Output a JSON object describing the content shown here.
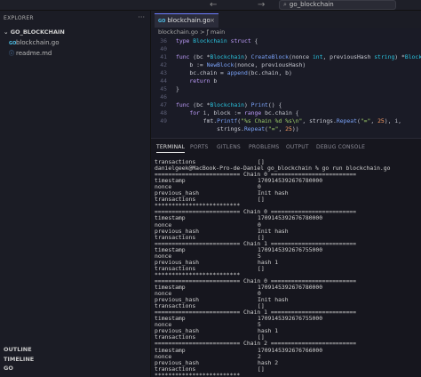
{
  "titlebar": {
    "back_icon": "arrow-left-icon",
    "forward_icon": "arrow-right-icon",
    "search_text": "go_blockchain"
  },
  "sidebar": {
    "header": "EXPLORER",
    "more": "···",
    "folder": "GO_BLOCKCHAIN",
    "files": [
      {
        "name": "blockchain.go",
        "icon": "go-file-icon"
      },
      {
        "name": "readme.md",
        "icon": "markdown-file-icon"
      }
    ],
    "bottom": [
      "OUTLINE",
      "TIMELINE",
      "GO"
    ]
  },
  "editor": {
    "tab": "blockchain.go",
    "breadcrumb": "blockchain.go > ƒ main",
    "lines": [
      {
        "n": "36",
        "t": "type Blockchain struct {"
      },
      {
        "n": "40",
        "t": ""
      },
      {
        "n": "41",
        "t": "func (bc *Blockchain) CreateBlock(nonce int, previousHash string) *Block {"
      },
      {
        "n": "42",
        "t": "    b := NewBlock(nonce, previousHash)"
      },
      {
        "n": "43",
        "t": "    bc.chain = append(bc.chain, b)"
      },
      {
        "n": "44",
        "t": "    return b"
      },
      {
        "n": "45",
        "t": "}"
      },
      {
        "n": "46",
        "t": ""
      },
      {
        "n": "47",
        "t": "func (bc *Blockchain) Print() {"
      },
      {
        "n": "48",
        "t": "    for i, block := range bc.chain {"
      },
      {
        "n": "49",
        "t": "        fmt.Printf(\"%s Chain %d %s\\n\", strings.Repeat(\"=\", 25), i,"
      },
      {
        "n": "",
        "t": "            strings.Repeat(\"=\", 25))"
      }
    ]
  },
  "panel": {
    "tabs": [
      "TERMINAL",
      "PORTS",
      "GITLENS",
      "PROBLEMS",
      "OUTPUT",
      "DEBUG CONSOLE"
    ],
    "active_tab": "TERMINAL",
    "terminal": [
      {
        "k": "transactions",
        "v": "[]"
      },
      {
        "k": "danielgeek@MacBook-Pro-de-Daniel go_blockchain % go run blockchain.go",
        "v": ""
      },
      {
        "k": "========================= Chain 0 =========================",
        "v": ""
      },
      {
        "k": "timestamp",
        "v": "1709145392676780000"
      },
      {
        "k": "nonce",
        "v": "0"
      },
      {
        "k": "previous_hash",
        "v": "Init hash"
      },
      {
        "k": "transactions",
        "v": "[]"
      },
      {
        "k": "*************************",
        "v": ""
      },
      {
        "k": "========================= Chain 0 =========================",
        "v": ""
      },
      {
        "k": "timestamp",
        "v": "1709145392676780000"
      },
      {
        "k": "nonce",
        "v": "0"
      },
      {
        "k": "previous_hash",
        "v": "Init hash"
      },
      {
        "k": "transactions",
        "v": "[]"
      },
      {
        "k": "========================= Chain 1 =========================",
        "v": ""
      },
      {
        "k": "timestamp",
        "v": "1709145392676755000"
      },
      {
        "k": "nonce",
        "v": "5"
      },
      {
        "k": "previous_hash",
        "v": "hash 1"
      },
      {
        "k": "transactions",
        "v": "[]"
      },
      {
        "k": "*************************",
        "v": ""
      },
      {
        "k": "========================= Chain 0 =========================",
        "v": ""
      },
      {
        "k": "timestamp",
        "v": "1709145392676780000"
      },
      {
        "k": "nonce",
        "v": "0"
      },
      {
        "k": "previous_hash",
        "v": "Init hash"
      },
      {
        "k": "transactions",
        "v": "[]"
      },
      {
        "k": "========================= Chain 1 =========================",
        "v": ""
      },
      {
        "k": "timestamp",
        "v": "1709145392676755000"
      },
      {
        "k": "nonce",
        "v": "5"
      },
      {
        "k": "previous_hash",
        "v": "hash 1"
      },
      {
        "k": "transactions",
        "v": "[]"
      },
      {
        "k": "========================= Chain 2 =========================",
        "v": ""
      },
      {
        "k": "timestamp",
        "v": "1709145392676766000"
      },
      {
        "k": "nonce",
        "v": "2"
      },
      {
        "k": "previous_hash",
        "v": "hash 2"
      },
      {
        "k": "transactions",
        "v": "[]"
      },
      {
        "k": "*************************",
        "v": ""
      }
    ]
  },
  "colors": {
    "accent": "#6d7dff",
    "keyword": "#bb9af7",
    "function": "#7aa2f7",
    "string": "#9ece6a"
  }
}
